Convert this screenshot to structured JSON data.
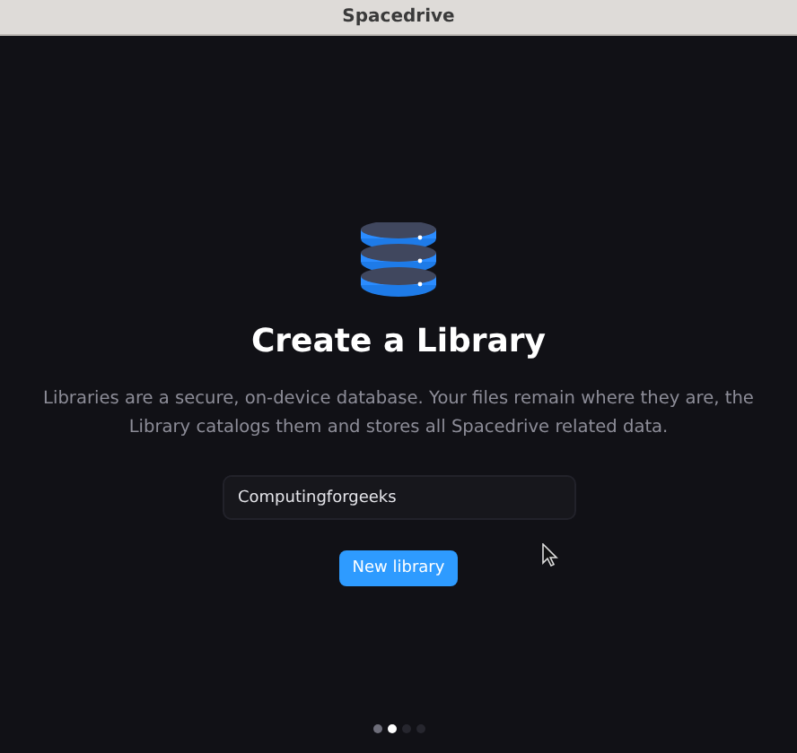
{
  "window": {
    "title": "Spacedrive"
  },
  "heading": "Create a Library",
  "description": "Libraries are a secure, on-device database. Your files remain where they are, the Library catalogs them and stores all Spacedrive related data.",
  "name_field": {
    "value": "Computingforgeeks"
  },
  "button": "New library",
  "pages": [
    {
      "selected": false
    },
    {
      "selected": true
    },
    {
      "selected": false
    },
    {
      "selected": false
    }
  ]
}
